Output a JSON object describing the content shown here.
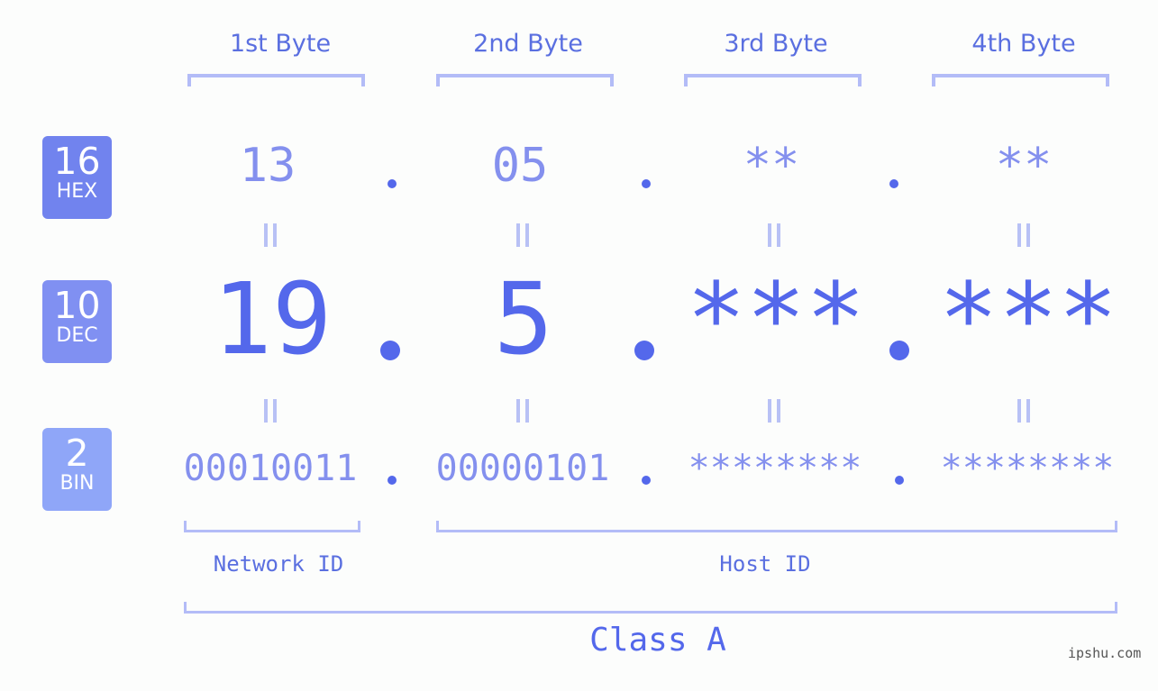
{
  "bytes": [
    "1st Byte",
    "2nd Byte",
    "3rd Byte",
    "4th Byte"
  ],
  "badges": {
    "hex": {
      "num": "16",
      "label": "HEX",
      "color": "#7183ee"
    },
    "dec": {
      "num": "10",
      "label": "DEC",
      "color": "#8090f2"
    },
    "bin": {
      "num": "2",
      "label": "BIN",
      "color": "#8fa6f8"
    }
  },
  "hex_values": [
    "13",
    "05",
    "**",
    "**"
  ],
  "dec_values": [
    "19",
    "5",
    "***",
    "***"
  ],
  "bin_values": [
    "00010011",
    "00000101",
    "********",
    "********"
  ],
  "separator": ".",
  "network_id_label": "Network ID",
  "host_id_label": "Host ID",
  "class_label": "Class A",
  "watermark": "ipshu.com",
  "colors": {
    "accent": "#5468eb",
    "muted": "#8490ee",
    "bracket": "#b3bcf7"
  }
}
